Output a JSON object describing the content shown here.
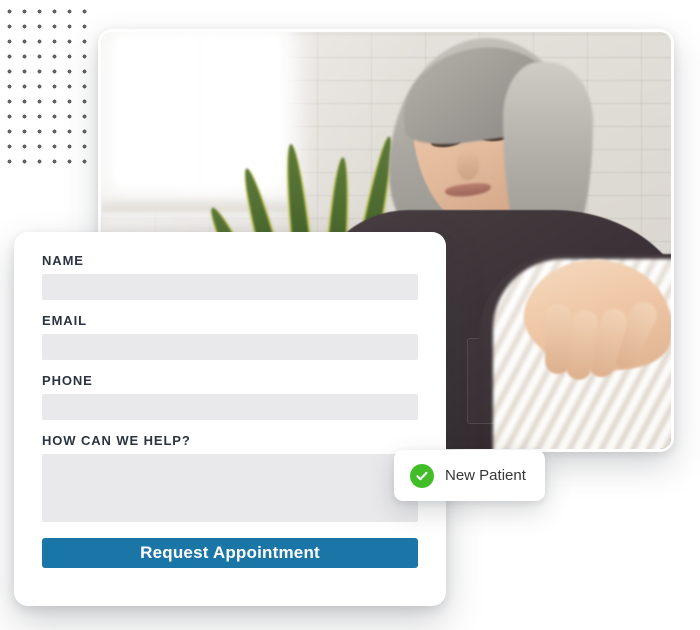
{
  "colors": {
    "accent_blue": "#1a76a6",
    "success_green": "#41bd28",
    "label_text": "#2b3440",
    "input_fill": "#e9e9eb",
    "card_background": "#ffffff",
    "page_background": "#ffffff",
    "dot_pattern": "#4a4a4a"
  },
  "decoration": {
    "dot_grid_name": "dot-grid-pattern"
  },
  "photo": {
    "alt": "Woman with gray hair sitting with a laptop in front of a white brick wall with a snake plant",
    "card_name": "photo-card"
  },
  "form": {
    "fields": [
      {
        "label": "NAME",
        "value": "",
        "placeholder": "",
        "type": "text"
      },
      {
        "label": "EMAIL",
        "value": "",
        "placeholder": "",
        "type": "email"
      },
      {
        "label": "PHONE",
        "value": "",
        "placeholder": "",
        "type": "tel"
      },
      {
        "label": "HOW CAN WE HELP?",
        "value": "",
        "placeholder": "",
        "type": "textarea"
      }
    ],
    "submit_label": "Request Appointment"
  },
  "badge": {
    "label": "New Patient",
    "icon": "check-circle-icon"
  }
}
